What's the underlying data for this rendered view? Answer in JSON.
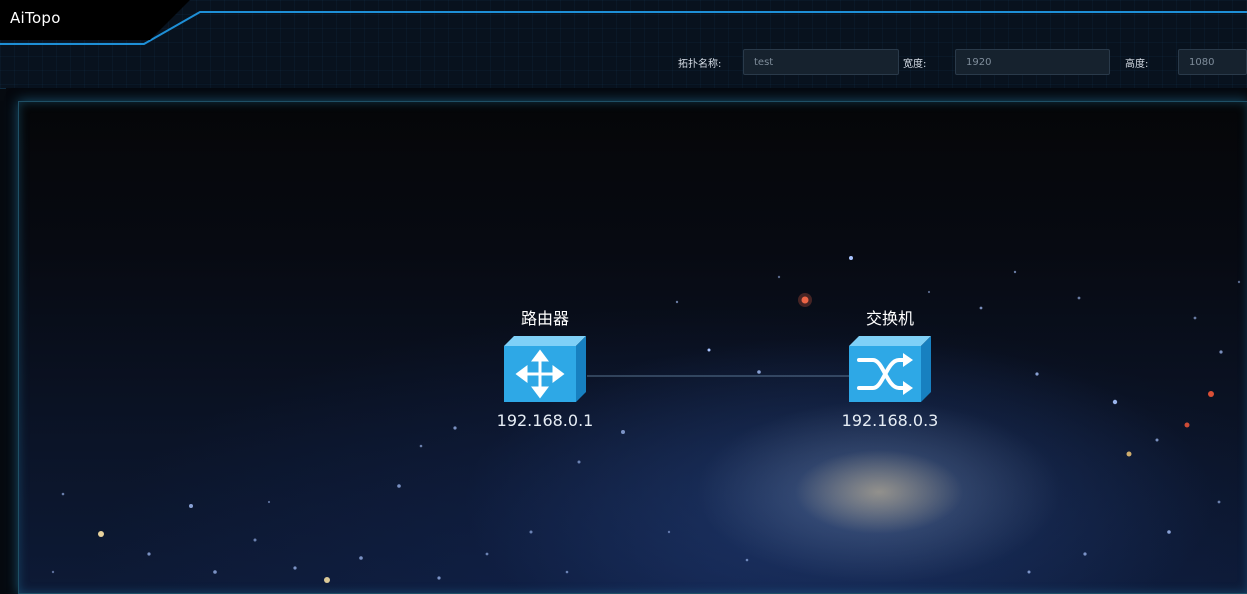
{
  "app": {
    "title": "AiTopo"
  },
  "form": {
    "name_label": "拓扑名称:",
    "name_value": "test",
    "width_label": "宽度:",
    "width_value": "1920",
    "height_label": "高度:",
    "height_value": "1080"
  },
  "topology": {
    "nodes": [
      {
        "label": "路由器",
        "ip": "192.168.0.1",
        "icon": "router-icon"
      },
      {
        "label": "交换机",
        "ip": "192.168.0.3",
        "icon": "switch-icon"
      }
    ]
  },
  "colors": {
    "accent": "#1e90d6",
    "device": "#2ea8e6",
    "header_bg": "#08121e"
  }
}
